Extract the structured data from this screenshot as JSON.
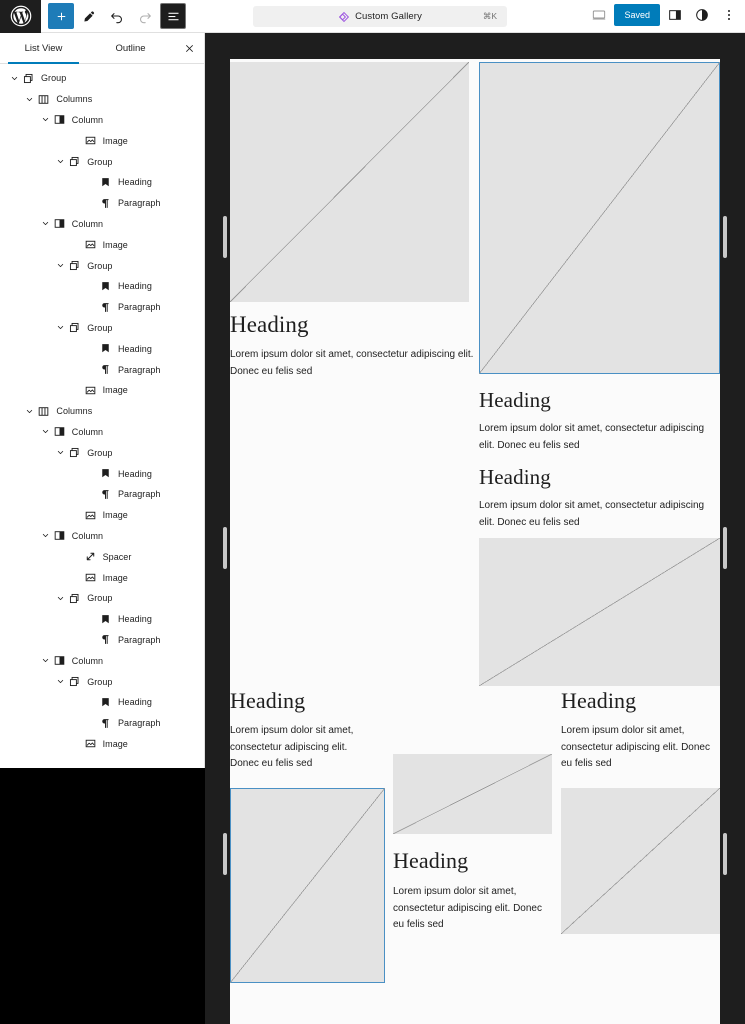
{
  "topbar": {
    "logo_icon": "wordpress-logo-icon",
    "tools": [
      {
        "name": "add-block-button",
        "icon": "plus-icon",
        "state": "primary"
      },
      {
        "name": "tools-edit-button",
        "icon": "pencil-icon",
        "state": "default"
      },
      {
        "name": "undo-button",
        "icon": "undo-arrow-icon",
        "state": "default"
      },
      {
        "name": "redo-button",
        "icon": "redo-arrow-icon",
        "state": "disabled"
      },
      {
        "name": "list-view-button",
        "icon": "list-view-icon",
        "state": "active"
      }
    ],
    "command_bar": {
      "icon": "wordpress-block-icon",
      "title": "Custom Gallery",
      "shortcut": "⌘K"
    },
    "right": {
      "preview_icon": "desktop-preview-icon",
      "saved_label": "Saved",
      "settings_icon": "settings-sidebar-icon",
      "styles_icon": "styles-contrast-icon",
      "more_icon": "more-options-icon"
    }
  },
  "sidebar": {
    "tabs": [
      {
        "label": "List View",
        "active": true
      },
      {
        "label": "Outline",
        "active": false
      }
    ],
    "close_icon": "close-icon",
    "close_label": "×",
    "tree": [
      {
        "depth": 0,
        "label": "Group",
        "icon": "group-icon",
        "expanded": true
      },
      {
        "depth": 1,
        "label": "Columns",
        "icon": "columns-icon",
        "expanded": true
      },
      {
        "depth": 2,
        "label": "Column",
        "icon": "column-icon",
        "expanded": true
      },
      {
        "depth": 4,
        "label": "Image",
        "icon": "image-icon",
        "expanded": null
      },
      {
        "depth": 3,
        "label": "Group",
        "icon": "group-icon",
        "expanded": true
      },
      {
        "depth": 5,
        "label": "Heading",
        "icon": "heading-icon",
        "expanded": null
      },
      {
        "depth": 5,
        "label": "Paragraph",
        "icon": "paragraph-icon",
        "expanded": null
      },
      {
        "depth": 2,
        "label": "Column",
        "icon": "column-icon",
        "expanded": true
      },
      {
        "depth": 4,
        "label": "Image",
        "icon": "image-icon",
        "expanded": null
      },
      {
        "depth": 3,
        "label": "Group",
        "icon": "group-icon",
        "expanded": true
      },
      {
        "depth": 5,
        "label": "Heading",
        "icon": "heading-icon",
        "expanded": null
      },
      {
        "depth": 5,
        "label": "Paragraph",
        "icon": "paragraph-icon",
        "expanded": null
      },
      {
        "depth": 3,
        "label": "Group",
        "icon": "group-icon",
        "expanded": true
      },
      {
        "depth": 5,
        "label": "Heading",
        "icon": "heading-icon",
        "expanded": null
      },
      {
        "depth": 5,
        "label": "Paragraph",
        "icon": "paragraph-icon",
        "expanded": null
      },
      {
        "depth": 4,
        "label": "Image",
        "icon": "image-icon",
        "expanded": null
      },
      {
        "depth": 1,
        "label": "Columns",
        "icon": "columns-icon",
        "expanded": true
      },
      {
        "depth": 2,
        "label": "Column",
        "icon": "column-icon",
        "expanded": true
      },
      {
        "depth": 3,
        "label": "Group",
        "icon": "group-icon",
        "expanded": true
      },
      {
        "depth": 5,
        "label": "Heading",
        "icon": "heading-icon",
        "expanded": null
      },
      {
        "depth": 5,
        "label": "Paragraph",
        "icon": "paragraph-icon",
        "expanded": null
      },
      {
        "depth": 4,
        "label": "Image",
        "icon": "image-icon",
        "expanded": null
      },
      {
        "depth": 2,
        "label": "Column",
        "icon": "column-icon",
        "expanded": true
      },
      {
        "depth": 4,
        "label": "Spacer",
        "icon": "spacer-icon",
        "expanded": null
      },
      {
        "depth": 4,
        "label": "Image",
        "icon": "image-icon",
        "expanded": null
      },
      {
        "depth": 3,
        "label": "Group",
        "icon": "group-icon",
        "expanded": true
      },
      {
        "depth": 5,
        "label": "Heading",
        "icon": "heading-icon",
        "expanded": null
      },
      {
        "depth": 5,
        "label": "Paragraph",
        "icon": "paragraph-icon",
        "expanded": null
      },
      {
        "depth": 2,
        "label": "Column",
        "icon": "column-icon",
        "expanded": true
      },
      {
        "depth": 3,
        "label": "Group",
        "icon": "group-icon",
        "expanded": true
      },
      {
        "depth": 5,
        "label": "Heading",
        "icon": "heading-icon",
        "expanded": null
      },
      {
        "depth": 5,
        "label": "Paragraph",
        "icon": "paragraph-icon",
        "expanded": null
      },
      {
        "depth": 4,
        "label": "Image",
        "icon": "image-icon",
        "expanded": null
      }
    ]
  },
  "content": {
    "heading": "Heading",
    "paragraph_long": "Lorem ipsum dolor sit amet, consectetur adipiscing elit. Donec eu felis sed",
    "paragraph_short": "Lorem ipsum dolor sit amet, consectetur adipiscing elit. Donec eu felis sed"
  },
  "colors": {
    "accent_blue": "#007cba",
    "selection_blue": "#4a90c4",
    "editor_bg": "#1e1e1e",
    "canvas_bg": "#fbfbfb",
    "placeholder_gray": "#e3e3e3"
  }
}
